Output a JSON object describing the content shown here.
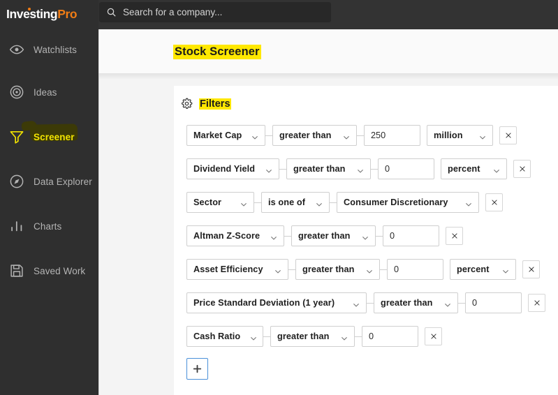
{
  "brand": {
    "name_part1": "Investing",
    "name_part2": "Pro"
  },
  "search": {
    "placeholder_text": "Search for a company...",
    "icon": "search-icon"
  },
  "sidebar": {
    "items": [
      {
        "label": "Watchlists",
        "icon": "eye-icon",
        "active": false
      },
      {
        "label": "Ideas",
        "icon": "target-icon",
        "active": false
      },
      {
        "label": "Screener",
        "icon": "funnel-icon",
        "active": true
      },
      {
        "label": "Data Explorer",
        "icon": "compass-icon",
        "active": false
      },
      {
        "label": "Charts",
        "icon": "bar-chart-icon",
        "active": false
      },
      {
        "label": "Saved Work",
        "icon": "floppy-disk-icon",
        "active": false
      }
    ]
  },
  "header": {
    "title": "Stock Screener"
  },
  "filters_panel": {
    "icon": "gear-icon",
    "title": "Filters",
    "add_button_label": "+",
    "remove_button_label": "×",
    "rows": [
      {
        "metric": "Market Cap",
        "operator": "greater than",
        "value": "250",
        "unit": "million"
      },
      {
        "metric": "Dividend Yield",
        "operator": "greater than",
        "value": "0",
        "unit": "percent"
      },
      {
        "metric": "Sector",
        "operator": "is one of",
        "value": "Consumer Discretionary",
        "unit": null
      },
      {
        "metric": "Altman Z-Score",
        "operator": "greater than",
        "value": "0",
        "unit": null
      },
      {
        "metric": "Asset Efficiency",
        "operator": "greater than",
        "value": "0",
        "unit": "percent"
      },
      {
        "metric": "Price Standard Deviation (1 year)",
        "operator": "greater than",
        "value": "0",
        "unit": null
      },
      {
        "metric": "Cash Ratio",
        "operator": "greater than",
        "value": "0",
        "unit": null
      }
    ]
  },
  "colors": {
    "sidebar_bg": "#2f2f2f",
    "topbar_bg": "#333333",
    "brand_orange": "#f07c15",
    "highlight_yellow": "#ffe800",
    "active_yellow": "#f2e400",
    "accent_blue": "#4a90d9"
  }
}
